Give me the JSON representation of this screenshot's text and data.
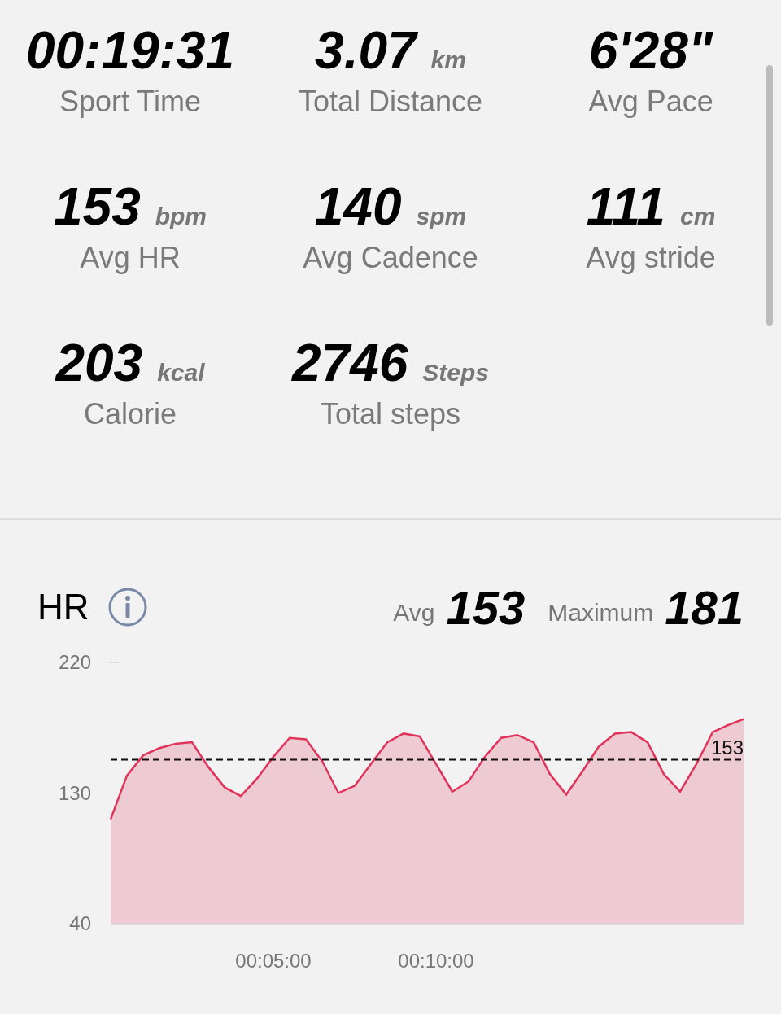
{
  "stats": [
    {
      "value": "00:19:31",
      "label": "Sport Time"
    },
    {
      "value": "3.07",
      "unit": "km",
      "label": "Total Distance"
    },
    {
      "value": "6'28\"",
      "label": "Avg Pace"
    },
    {
      "value": "153",
      "unit": "bpm",
      "label": "Avg HR"
    },
    {
      "value": "140",
      "unit": "spm",
      "label": "Avg Cadence"
    },
    {
      "value": "111",
      "unit": "cm",
      "label": "Avg stride"
    },
    {
      "value": "203",
      "unit": "kcal",
      "label": "Calorie"
    },
    {
      "value": "2746",
      "unit": "Steps",
      "label": "Total steps"
    }
  ],
  "hr": {
    "title": "HR",
    "avg_label": "Avg",
    "avg": "153",
    "max_label": "Maximum",
    "max": "181",
    "chart_data": {
      "type": "area",
      "ylim": [
        40,
        220
      ],
      "yticks": [
        40,
        130,
        220
      ],
      "xlim": [
        0,
        19.45
      ],
      "xticks": [
        {
          "value": 5,
          "label": "00:05:00"
        },
        {
          "value": 10,
          "label": "00:10:00"
        }
      ],
      "x": [
        0,
        0.5,
        1,
        1.5,
        2,
        2.5,
        3,
        3.5,
        4,
        4.5,
        5,
        5.5,
        6,
        6.5,
        7,
        7.5,
        8,
        8.5,
        9,
        9.5,
        10,
        10.5,
        11,
        11.5,
        12,
        12.5,
        13,
        13.5,
        14,
        14.5,
        15,
        15.5,
        16,
        16.5,
        17,
        17.5,
        18,
        18.5,
        19,
        19.45
      ],
      "series": [
        {
          "color": "#e0345a",
          "values": [
            112,
            142,
            156,
            161,
            164,
            165,
            148,
            134,
            128,
            140,
            155,
            168,
            167,
            152,
            130,
            135,
            150,
            165,
            171,
            169,
            150,
            131,
            138,
            155,
            168,
            170,
            165,
            143,
            129,
            145,
            162,
            171,
            172,
            165,
            143,
            131,
            150,
            172,
            177,
            181
          ]
        },
        {
          "name": "153",
          "type": "line",
          "line_style": "dashed",
          "color": "#111111",
          "values": [
            153,
            153,
            153,
            153,
            153,
            153,
            153,
            153,
            153,
            153,
            153,
            153,
            153,
            153,
            153,
            153,
            153,
            153,
            153,
            153,
            153,
            153,
            153,
            153,
            153,
            153,
            153,
            153,
            153,
            153,
            153,
            153,
            153,
            153,
            153,
            153,
            153,
            153,
            153,
            153
          ]
        }
      ]
    }
  }
}
